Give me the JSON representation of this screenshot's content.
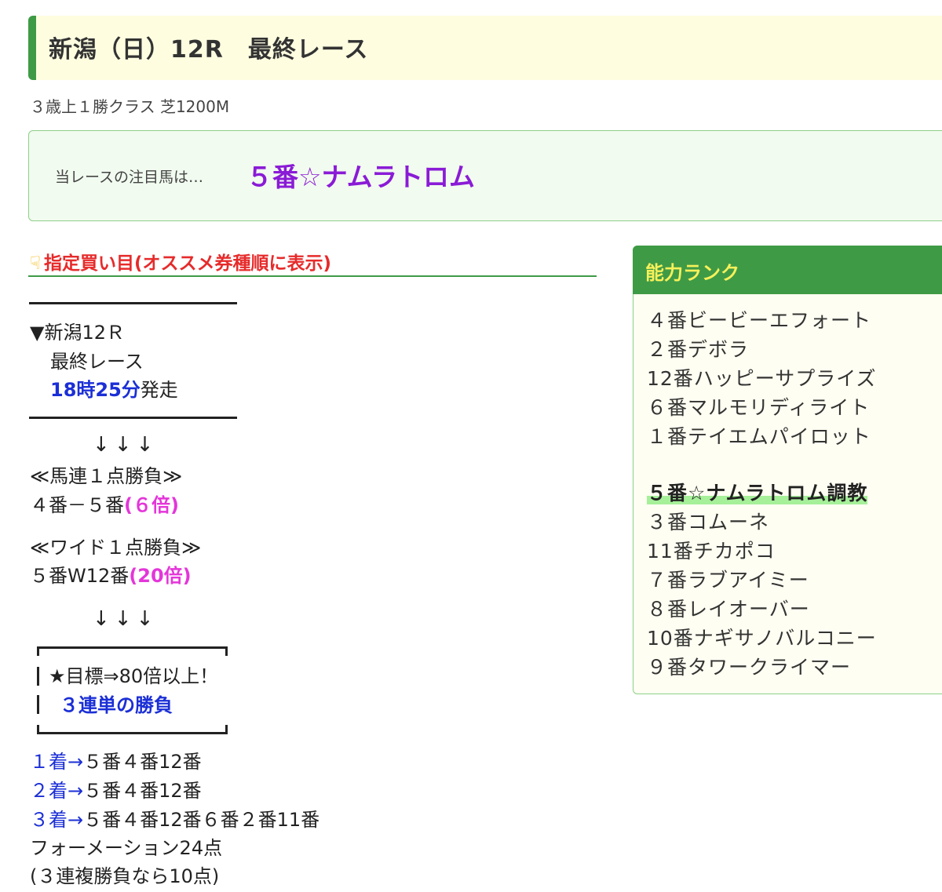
{
  "header": {
    "title": "新潟（日）12R　最終レース"
  },
  "race_info": "３歳上１勝クラス  芝1200M",
  "notice": {
    "label": "当レースの注目馬は…",
    "horse": "５番☆ナムラトロム"
  },
  "picks": {
    "heading": "指定買い目(オススメ券種順に表示)",
    "race_line": "▼新潟12Ｒ",
    "race_name": "最終レース",
    "start_time": "18時25分",
    "start_suffix": "発走",
    "arrows": "↓↓↓",
    "umaren_title": "≪馬連１点勝負≫",
    "umaren_combo": "４番－５番",
    "umaren_odds": "(６倍)",
    "wide_title": "≪ワイド１点勝負≫",
    "wide_combo": "５番W12番",
    "wide_odds": "(20倍)",
    "target_line": "★目標⇒80倍以上！",
    "target_bet": "３連単の勝負",
    "first_label": "１着→",
    "first_horses": "５番４番12番",
    "second_label": "２着→",
    "second_horses": "５番４番12番",
    "third_label": "３着→",
    "third_horses": "５番４番12番６番２番11番",
    "formation": "フォーメーション24点",
    "trio_note": "(３連複勝負なら10点)"
  },
  "ability_rank": {
    "title": "能力ランク",
    "top": [
      "４番ビービーエフォート",
      "２番デボラ",
      "12番ハッピーサプライズ",
      "６番マルモリディライト",
      "１番テイエムパイロット"
    ],
    "highlight": "５番☆ナムラトロム調教",
    "rest": [
      "３番コムーネ",
      "11番チカポコ",
      "７番ラブアイミー",
      "８番レイオーバー",
      "10番ナギサノバルコニー",
      "９番タワークライマー"
    ]
  },
  "colors": {
    "accent_green": "#3f9a46",
    "header_bg": "#fefde0",
    "notice_horse": "#8a1bd6",
    "heading_red": "#e62b2b",
    "link_blue": "#1b2fd6",
    "odds_magenta": "#e436d9",
    "rank_title_yellow": "#f7f15a",
    "highlight_green": "#a6f09a"
  },
  "icons": {
    "heading_icon": "pointing-hand-icon"
  }
}
